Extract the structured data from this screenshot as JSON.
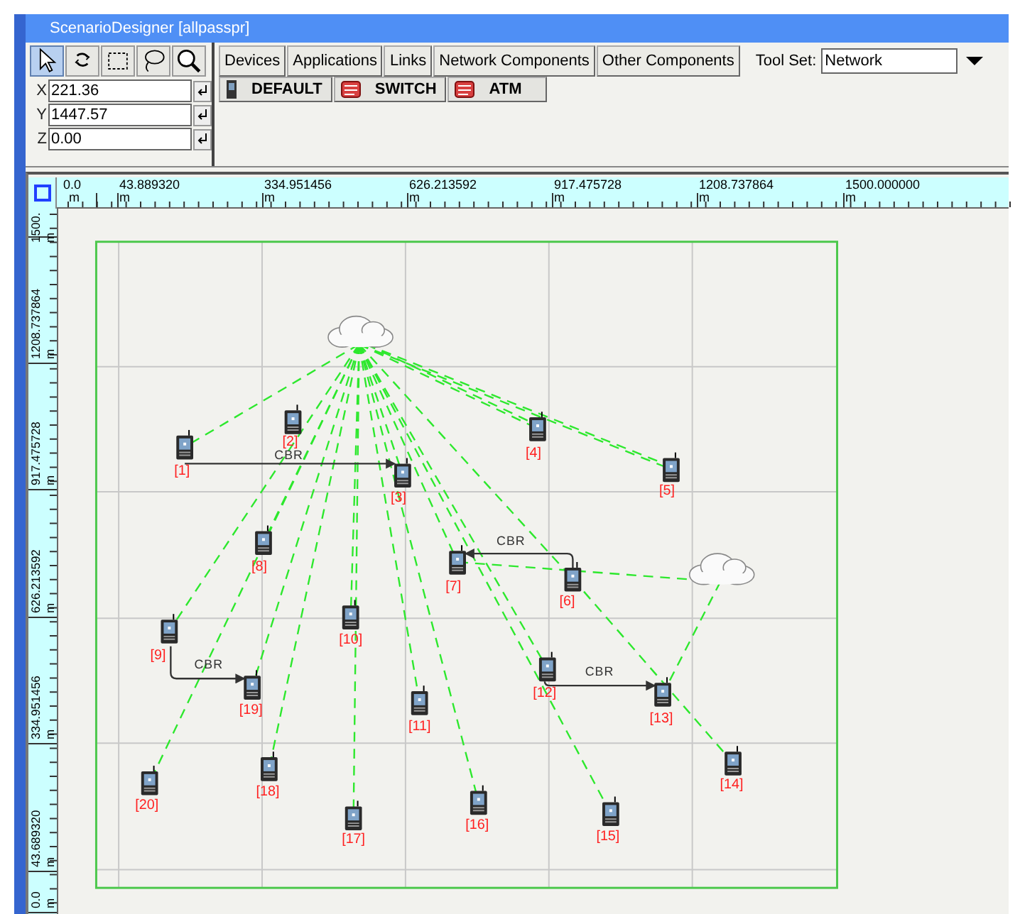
{
  "window": {
    "title": "ScenarioDesigner [allpasspr]"
  },
  "tools": [
    {
      "kind": "pointer",
      "selected": true
    },
    {
      "kind": "rotate",
      "selected": false
    },
    {
      "kind": "rectangle",
      "selected": false
    },
    {
      "kind": "lasso",
      "selected": false
    },
    {
      "kind": "zoom",
      "selected": false
    }
  ],
  "coordinates": [
    {
      "axis": "X",
      "value": "221.36"
    },
    {
      "axis": "Y",
      "value": "1447.57"
    },
    {
      "axis": "Z",
      "value": "0.00"
    }
  ],
  "tabs": [
    "Devices",
    "Applications",
    "Links",
    "Network Components",
    "Other Components"
  ],
  "tool_set": {
    "label": "Tool Set:",
    "value": "Network"
  },
  "palette": [
    {
      "kind": "device",
      "label": "DEFAULT"
    },
    {
      "kind": "switch",
      "label": "SWITCH"
    },
    {
      "kind": "switch",
      "label": "ATM"
    }
  ],
  "ruler_top": [
    {
      "value": "0.0",
      "unit": "m"
    },
    {
      "value": "43.889320",
      "unit": "m"
    },
    {
      "value": "334.951456",
      "unit": "m"
    },
    {
      "value": "626.213592",
      "unit": "m"
    },
    {
      "value": "917.475728",
      "unit": "m"
    },
    {
      "value": "1208.737864",
      "unit": "m"
    },
    {
      "value": "1500.000000",
      "unit": "m"
    }
  ],
  "ruler_left": [
    {
      "value": "1500.",
      "unit": "m"
    },
    {
      "value": "1208.737864",
      "unit": "m"
    },
    {
      "value": "917.475728",
      "unit": "m"
    },
    {
      "value": "626.213592",
      "unit": "m"
    },
    {
      "value": "334.951456",
      "unit": "m"
    },
    {
      "value": "43.689320",
      "unit": "m"
    },
    {
      "value": "0.0",
      "unit": "m"
    }
  ],
  "nodes": [
    {
      "kind": "cloud"
    },
    {
      "kind": "cloud"
    },
    {
      "kind": "phone",
      "label": "[1]"
    },
    {
      "kind": "phone",
      "label": "[2]"
    },
    {
      "kind": "phone",
      "label": "[3]"
    },
    {
      "kind": "phone",
      "label": "[4]"
    },
    {
      "kind": "phone",
      "label": "[5]"
    },
    {
      "kind": "phone",
      "label": "[6]"
    },
    {
      "kind": "phone",
      "label": "[7]"
    },
    {
      "kind": "phone",
      "label": "[8]"
    },
    {
      "kind": "phone",
      "label": "[9]"
    },
    {
      "kind": "phone",
      "label": "[10]"
    },
    {
      "kind": "phone",
      "label": "[11]"
    },
    {
      "kind": "phone",
      "label": "[12]"
    },
    {
      "kind": "phone",
      "label": "[13]"
    },
    {
      "kind": "phone",
      "label": "[14]"
    },
    {
      "kind": "phone",
      "label": "[15]"
    },
    {
      "kind": "phone",
      "label": "[16]"
    },
    {
      "kind": "phone",
      "label": "[17]"
    },
    {
      "kind": "phone",
      "label": "[18]"
    },
    {
      "kind": "phone",
      "label": "[19]"
    },
    {
      "kind": "phone",
      "label": "[20]"
    }
  ],
  "flows": [
    {
      "label": "CBR"
    },
    {
      "label": "CBR"
    },
    {
      "label": "CBR"
    },
    {
      "label": "CBR"
    }
  ]
}
